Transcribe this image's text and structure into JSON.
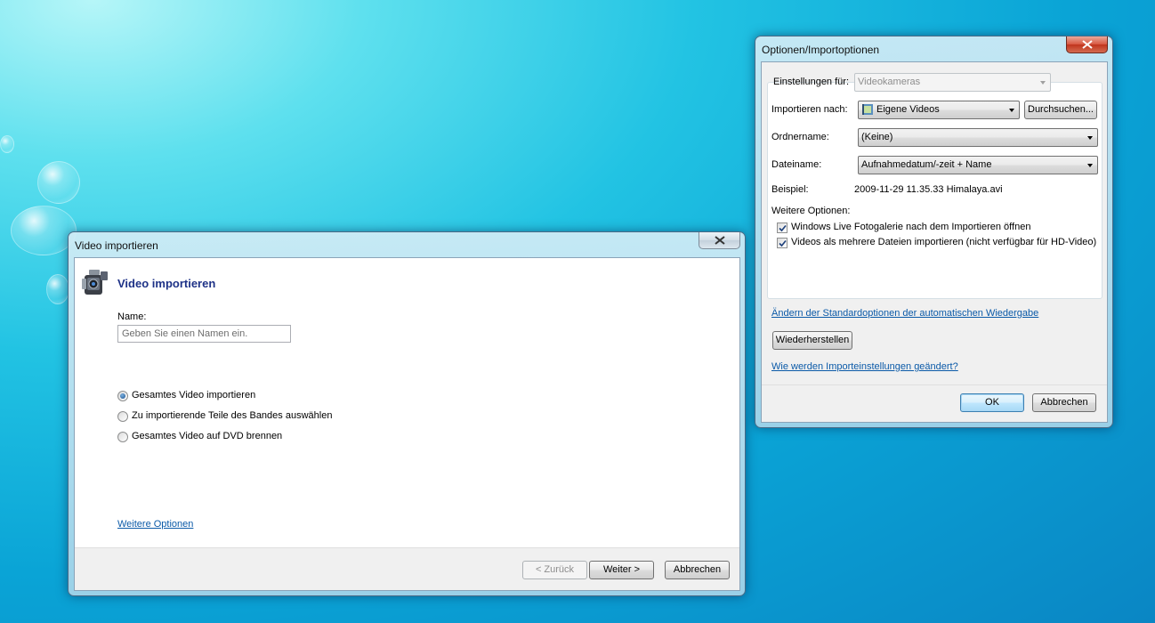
{
  "video_window": {
    "title": "Video importieren",
    "heading": "Video importieren",
    "name_label": "Name:",
    "name_placeholder": "Geben Sie einen Namen ein.",
    "options": [
      {
        "label": "Gesamtes Video importieren",
        "selected": true
      },
      {
        "label": "Zu importierende Teile des Bandes auswählen",
        "selected": false
      },
      {
        "label": "Gesamtes Video auf DVD brennen",
        "selected": false
      }
    ],
    "more_options_link": "Weitere Optionen",
    "back_button": "< Zurück",
    "next_button": "Weiter >",
    "cancel_button": "Abbrechen"
  },
  "options_window": {
    "title": "Optionen/Importoptionen",
    "settings_for_label": "Einstellungen für:",
    "settings_for_value": "Videokameras",
    "import_to_label": "Importieren nach:",
    "import_to_value": "Eigene Videos",
    "browse_button": "Durchsuchen...",
    "folder_name_label": "Ordnername:",
    "folder_name_value": "(Keine)",
    "file_name_label": "Dateiname:",
    "file_name_value": "Aufnahmedatum/-zeit + Name",
    "example_label": "Beispiel:",
    "example_value": "2009-11-29 11.35.33 Himalaya.avi",
    "more_options_label": "Weitere Optionen:",
    "checkboxes": [
      {
        "label": "Windows Live Fotogalerie nach dem Importieren öffnen",
        "checked": true
      },
      {
        "label": "Videos als mehrere Dateien importieren (nicht verfügbar für HD-Video)",
        "checked": true
      }
    ],
    "autoplay_link": "Ändern der Standardoptionen der automatischen Wiedergabe",
    "restore_button": "Wiederherstellen",
    "help_link": "Wie werden Importeinstellungen geändert?",
    "ok_button": "OK",
    "cancel_button": "Abbrechen"
  },
  "colors": {
    "heading": "#1e3287",
    "link": "#0b5aa8",
    "close_red": "#c0351d"
  }
}
